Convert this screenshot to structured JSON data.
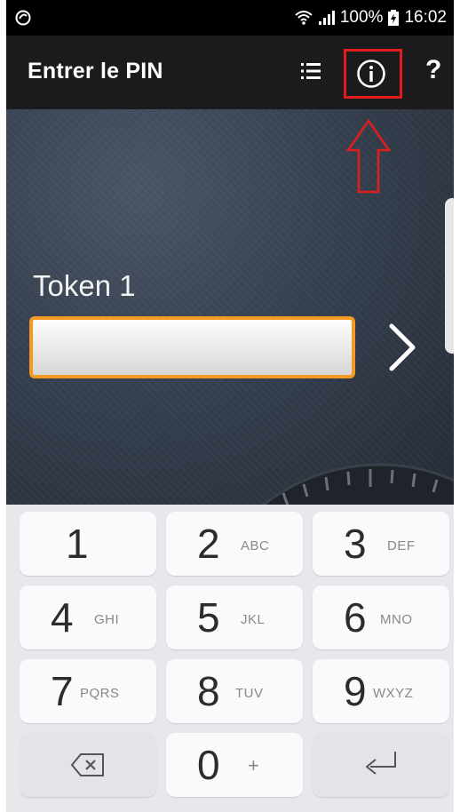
{
  "status_bar": {
    "battery_percent": "100%",
    "time": "16:02",
    "icons": [
      "app-sync-icon",
      "wifi-icon",
      "signal-icon",
      "battery-icon"
    ]
  },
  "action_bar": {
    "title": "Entrer le PIN",
    "actions": [
      "list-icon",
      "info-icon",
      "help-icon"
    ],
    "help_label": "?"
  },
  "content": {
    "token_label": "Token 1",
    "pin_value": "",
    "field_border_color": "#f39a25",
    "highlight_color": "#e11d1d"
  },
  "keypad": {
    "keys": [
      {
        "digit": "1",
        "letters": ""
      },
      {
        "digit": "2",
        "letters": "ABC"
      },
      {
        "digit": "3",
        "letters": "DEF"
      },
      {
        "digit": "4",
        "letters": "GHI"
      },
      {
        "digit": "5",
        "letters": "JKL"
      },
      {
        "digit": "6",
        "letters": "MNO"
      },
      {
        "digit": "7",
        "letters": "PQRS"
      },
      {
        "digit": "8",
        "letters": "TUV"
      },
      {
        "digit": "9",
        "letters": "WXYZ"
      },
      {
        "digit": "0",
        "letters": "+"
      }
    ],
    "special": [
      "backspace-icon",
      "enter-icon"
    ]
  }
}
